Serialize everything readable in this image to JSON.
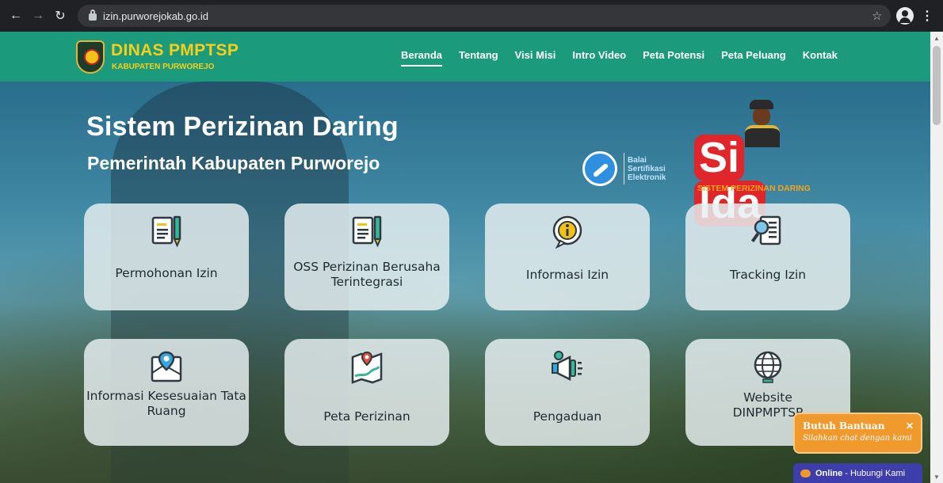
{
  "browser": {
    "url": "izin.purworejokab.go.id",
    "back_icon": "arrow-left-icon",
    "forward_icon": "arrow-right-icon",
    "reload_icon": "reload-icon"
  },
  "brand": {
    "title": "DINAS PMPTSP",
    "subtitle": "KABUPATEN PURWOREJO"
  },
  "nav": [
    {
      "label": "Beranda",
      "active": true
    },
    {
      "label": "Tentang"
    },
    {
      "label": "Visi Misi"
    },
    {
      "label": "Intro Video"
    },
    {
      "label": "Peta Potensi"
    },
    {
      "label": "Peta Peluang"
    },
    {
      "label": "Kontak"
    }
  ],
  "hero": {
    "title": "Sistem Perizinan Daring",
    "subtitle": "Pemerintah Kabupaten Purworejo"
  },
  "bsre": {
    "line1": "Balai",
    "line2": "Sertifikasi",
    "line3": "Elektronik"
  },
  "silda": {
    "word_left": "Si",
    "word_right": "lda",
    "tagline": "SISTEM PERIZINAN DARING"
  },
  "cards": [
    {
      "label": "Permohonan Izin",
      "icon": "document-pen-icon"
    },
    {
      "label": "OSS Perizinan Berusaha Terintegrasi",
      "icon": "document-pen-icon"
    },
    {
      "label": "Informasi Izin",
      "icon": "info-icon"
    },
    {
      "label": "Tracking Izin",
      "icon": "search-document-icon"
    },
    {
      "label": "Informasi Kesesuaian Tata Ruang",
      "icon": "map-pin-icon"
    },
    {
      "label": "Peta Perizinan",
      "icon": "map-route-icon"
    },
    {
      "label": "Pengaduan",
      "icon": "megaphone-icon"
    },
    {
      "label": "Website DINPMPTSP",
      "icon": "globe-icon"
    }
  ],
  "chat": {
    "title": "Butuh Bantuan",
    "subtitle": "Silahkan chat dengan kami",
    "status": "Online",
    "cta": " - Hubungi Kami"
  },
  "colors": {
    "header_green": "#1b9a7c",
    "brand_yellow": "#f5cf1a",
    "chat_orange": "#f09a2e",
    "chat_blue": "#3d3dab"
  }
}
